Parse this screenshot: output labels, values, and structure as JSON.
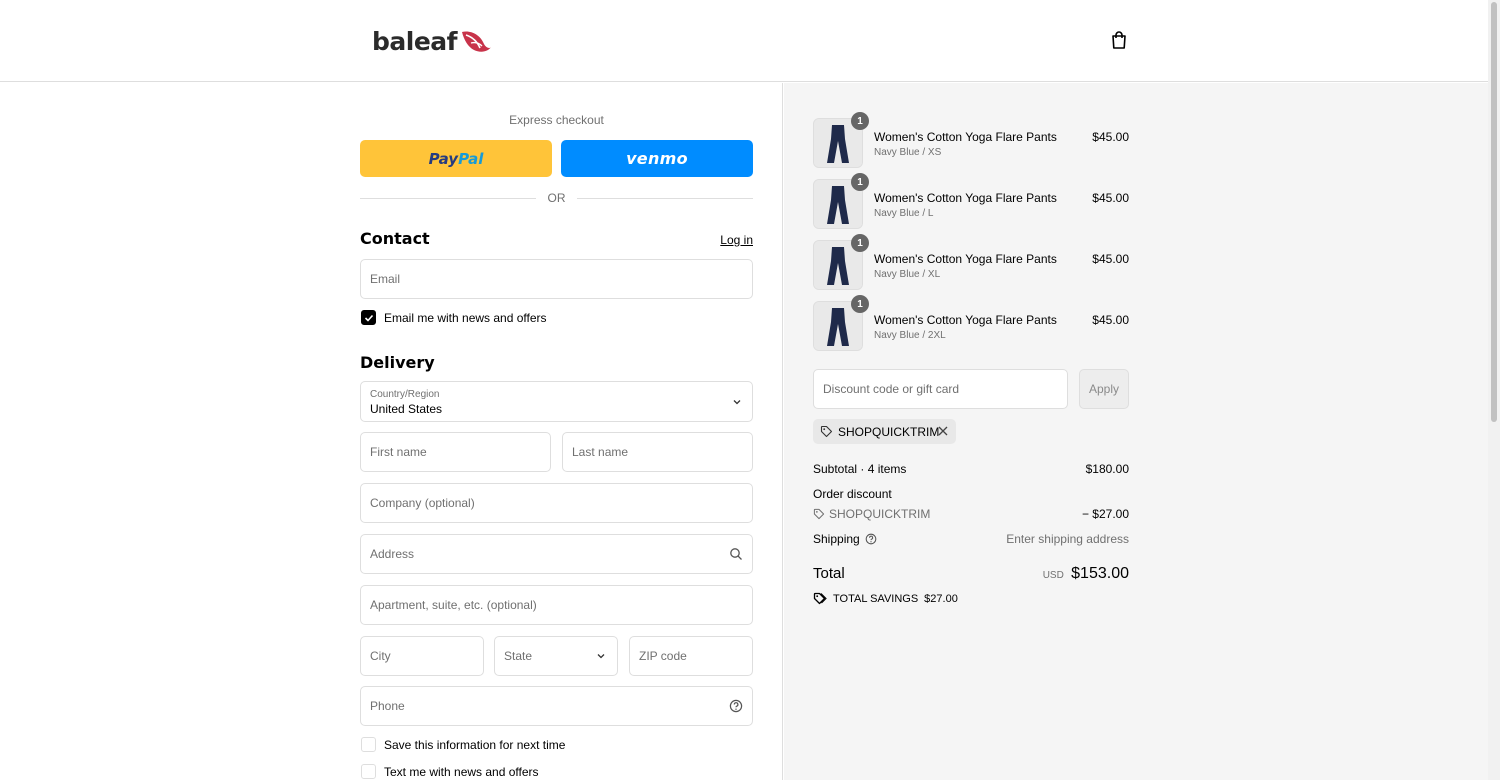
{
  "header": {
    "logo_text": "baleaf",
    "cart_icon": "shopping-bag-icon"
  },
  "express": {
    "label": "Express checkout",
    "paypal_pay": "Pay",
    "paypal_pal": "Pal",
    "venmo_label": "venmo",
    "or": "OR"
  },
  "contact": {
    "title": "Contact",
    "login_link": "Log in",
    "email_placeholder": "Email",
    "news_checkbox_label": "Email me with news and offers",
    "news_checked": true
  },
  "delivery": {
    "title": "Delivery",
    "country_label": "Country/Region",
    "country_value": "United States",
    "first_name_placeholder": "First name",
    "last_name_placeholder": "Last name",
    "company_placeholder": "Company (optional)",
    "address_placeholder": "Address",
    "apartment_placeholder": "Apartment, suite, etc. (optional)",
    "city_placeholder": "City",
    "state_placeholder": "State",
    "zip_placeholder": "ZIP code",
    "phone_placeholder": "Phone",
    "save_info_label": "Save this information for next time",
    "text_news_label": "Text me with news and offers"
  },
  "cart": {
    "items": [
      {
        "name": "Women's Cotton Yoga Flare Pants",
        "variant": "Navy Blue / XS",
        "price": "$45.00",
        "qty": "1"
      },
      {
        "name": "Women's Cotton Yoga Flare Pants",
        "variant": "Navy Blue / L",
        "price": "$45.00",
        "qty": "1"
      },
      {
        "name": "Women's Cotton Yoga Flare Pants",
        "variant": "Navy Blue / XL",
        "price": "$45.00",
        "qty": "1"
      },
      {
        "name": "Women's Cotton Yoga Flare Pants",
        "variant": "Navy Blue / 2XL",
        "price": "$45.00",
        "qty": "1"
      }
    ],
    "discount_placeholder": "Discount code or gift card",
    "apply_label": "Apply",
    "applied_code": "SHOPQUICKTRIM"
  },
  "summary": {
    "subtotal_label": "Subtotal · 4 items",
    "subtotal_value": "$180.00",
    "order_discount_label": "Order discount",
    "discount_code": "SHOPQUICKTRIM",
    "discount_value": "− $27.00",
    "shipping_label": "Shipping",
    "shipping_value": "Enter shipping address",
    "total_label": "Total",
    "currency": "USD",
    "total_value": "$153.00",
    "savings_label": "TOTAL SAVINGS",
    "savings_value": "$27.00"
  },
  "colors": {
    "paypal": "#ffc439",
    "venmo": "#008cff",
    "logo_accent": "#c8334a"
  }
}
